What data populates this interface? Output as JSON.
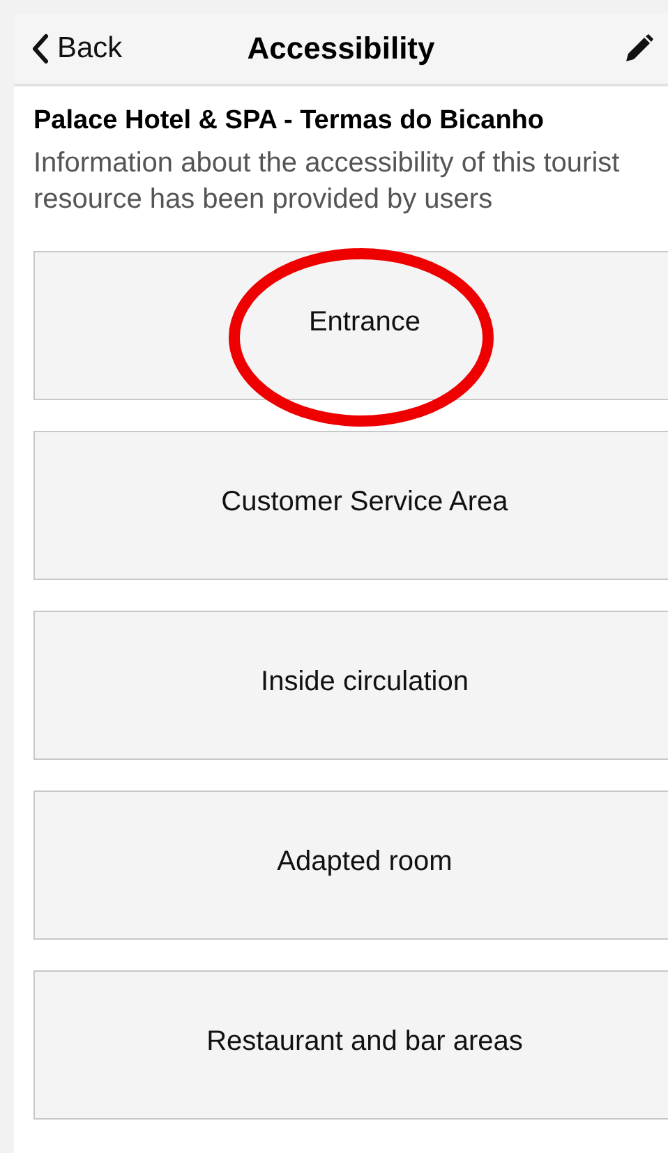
{
  "header": {
    "back_label": "Back",
    "title": "Accessibility"
  },
  "resource": {
    "name": "Palace Hotel & SPA - Termas do Bicanho",
    "description": "Information about the accessibility of this tourist resource has been provided by users"
  },
  "sections": [
    {
      "label": "Entrance",
      "highlighted": true
    },
    {
      "label": "Customer Service Area",
      "highlighted": false
    },
    {
      "label": "Inside circulation",
      "highlighted": false
    },
    {
      "label": "Adapted room",
      "highlighted": false
    },
    {
      "label": "Restaurant and bar areas",
      "highlighted": false
    }
  ]
}
